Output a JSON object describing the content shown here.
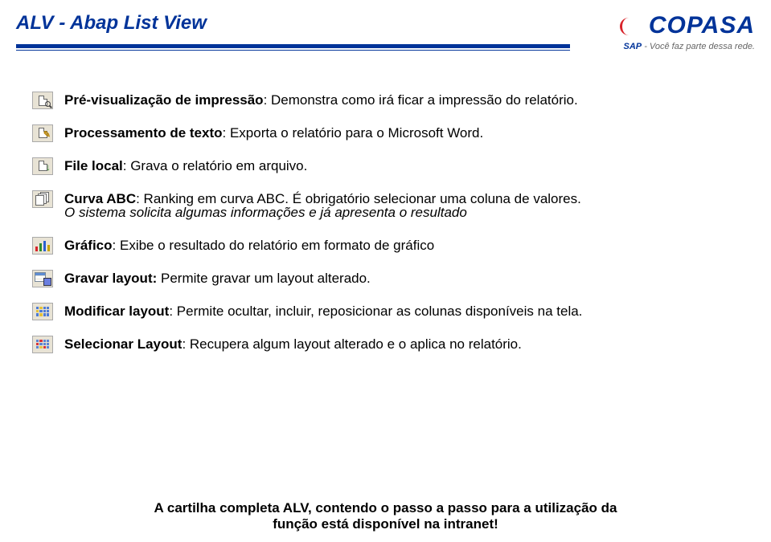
{
  "header": {
    "title": "ALV - Abap List View",
    "logo": {
      "main": "COPASA",
      "sub_prefix": "SAP",
      "sub_text": " - Você faz parte dessa rede."
    }
  },
  "items": [
    {
      "icon": "print-preview",
      "label": "Pré-visualização de impressão",
      "desc": ": Demonstra como irá ficar  a impressão do relatório."
    },
    {
      "icon": "word-export",
      "label": "Processamento de texto",
      "desc": ": Exporta o relatório para o Microsoft Word."
    },
    {
      "icon": "file-local",
      "label": "File local",
      "desc": ": Grava o relatório em arquivo."
    },
    {
      "icon": "abc-curve",
      "label": "Curva ABC",
      "desc": ": Ranking em curva ABC. É obrigatório selecionar uma coluna de valores.",
      "note": "O sistema solicita algumas  informações e já apresenta o resultado"
    },
    {
      "icon": "chart",
      "label": "Gráfico",
      "desc": ": Exibe o resultado do relatório em formato de gráfico"
    },
    {
      "icon": "save-layout",
      "label": "Gravar layout:",
      "desc": " Permite gravar um layout alterado."
    },
    {
      "icon": "modify-layout",
      "label": "Modificar layout",
      "desc": ": Permite ocultar, incluir, reposicionar as colunas disponíveis na tela."
    },
    {
      "icon": "select-layout",
      "label": "Selecionar Layout",
      "desc": ": Recupera algum layout alterado e o aplica no relatório."
    }
  ],
  "footer": {
    "line1": "A cartilha completa ALV, contendo o passo a passo para a utilização da",
    "line2": "função está disponível na intranet!"
  }
}
